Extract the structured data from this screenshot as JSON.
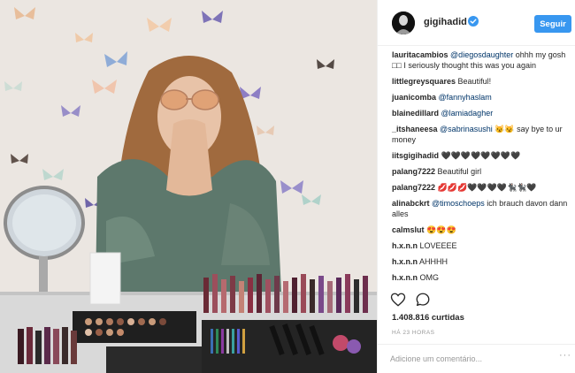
{
  "post": {
    "username": "gigihadid",
    "follow_label": "Seguir",
    "likes": "1.408.816 curtidas",
    "time_ago": "HÁ 23 HORAS",
    "comment_placeholder": "Adicione um comentário...",
    "more_symbol": "···",
    "accent_color": "#3897f0"
  },
  "comments": [
    {
      "user": "lauritacambios",
      "mention": "@diegosdaughter",
      "text": " ohhh my gosh □□ I seriously thought this was you again"
    },
    {
      "user": "littlegreysquares",
      "mention": "",
      "text": "Beautiful!"
    },
    {
      "user": "juanicomba",
      "mention": "@fannyhaslam",
      "text": ""
    },
    {
      "user": "blainedillard",
      "mention": "@lamiadagher",
      "text": ""
    },
    {
      "user": "_itshaneesa",
      "mention": "@sabrinasushi",
      "text": " 😼😼 say bye to ur money"
    },
    {
      "user": "iitsgigihadid",
      "mention": "",
      "text": "🖤🖤🖤🖤🖤🖤🖤🖤"
    },
    {
      "user": "palang7222",
      "mention": "",
      "text": "Beautiful girl"
    },
    {
      "user": "palang7222",
      "mention": "",
      "text": "💋💋💋🖤🖤🖤🖤🐈‍⬛🐈‍⬛🖤"
    },
    {
      "user": "alinabckrt",
      "mention": "@timoschoeps",
      "text": " ich brauch davon dann alles"
    },
    {
      "user": "calmslut",
      "mention": "",
      "text": "😍😍😍"
    },
    {
      "user": "h.x.n.n",
      "mention": "",
      "text": "LOVEEEE"
    },
    {
      "user": "h.x.n.n",
      "mention": "",
      "text": "AHHHH"
    },
    {
      "user": "h.x.n.n",
      "mention": "",
      "text": "OMG"
    }
  ]
}
